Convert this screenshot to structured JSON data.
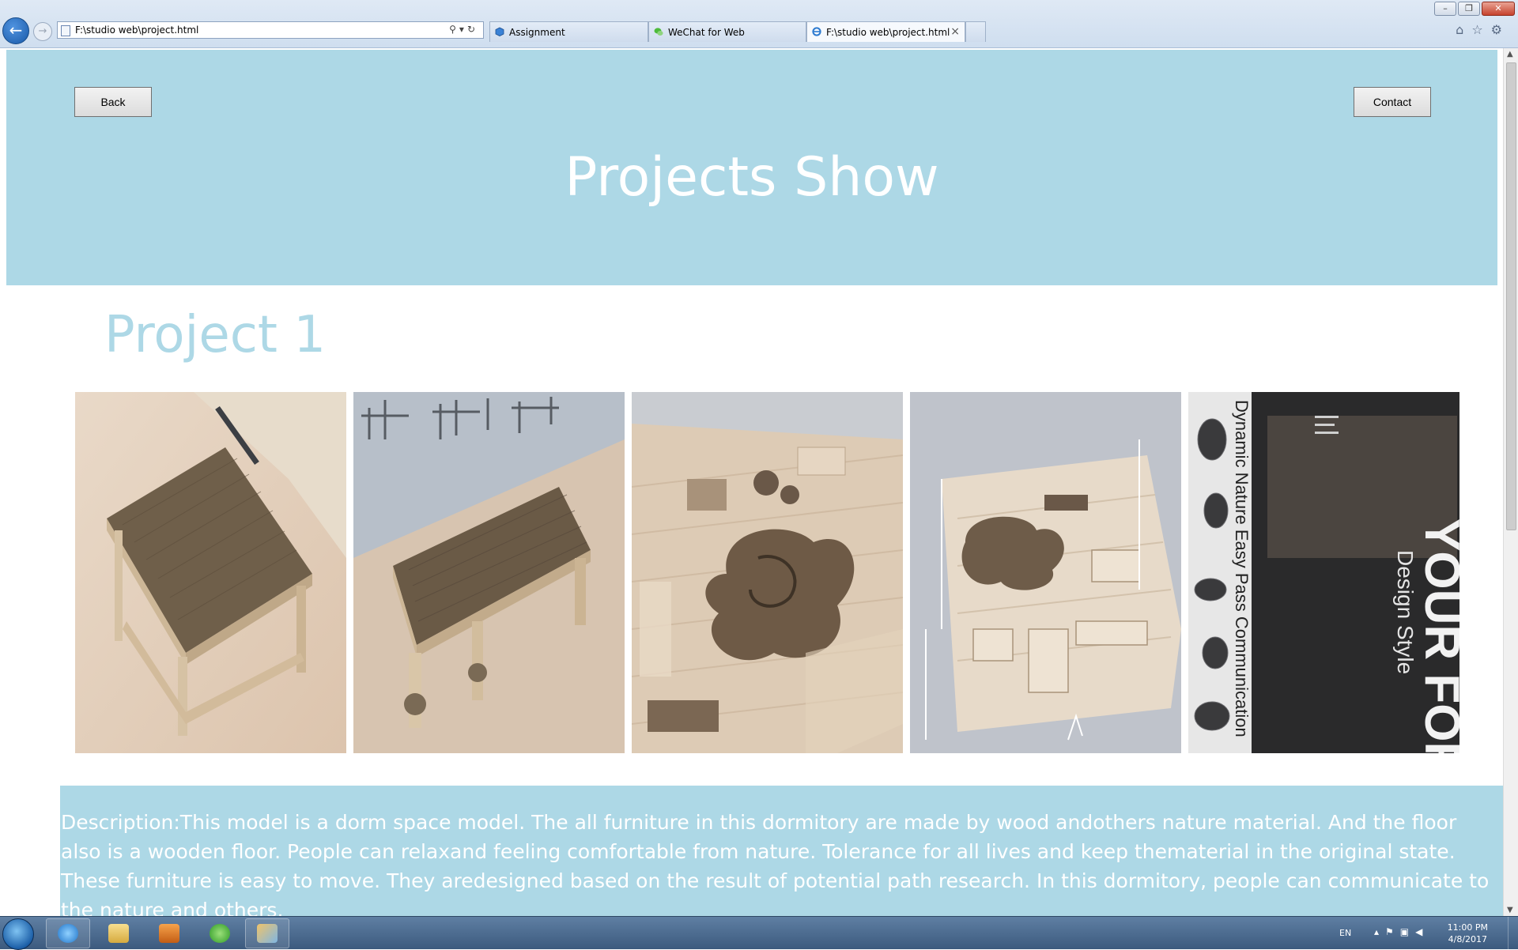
{
  "browser": {
    "address_url": "F:\\studio web\\project.html",
    "tabs": [
      {
        "label": "Assignment"
      },
      {
        "label": "WeChat for Web"
      },
      {
        "label": "F:\\studio web\\project.html"
      }
    ]
  },
  "header": {
    "back_label": "Back",
    "contact_label": "Contact",
    "title": "Projects Show",
    "background_color": "#add8e6"
  },
  "project": {
    "title": "Project 1",
    "photos": [
      {
        "icon": "bench-model-photo"
      },
      {
        "icon": "bench-model-photo"
      },
      {
        "icon": "dorm-model-photo"
      },
      {
        "icon": "dorm-model-photo"
      },
      {
        "icon": "poster-photo"
      }
    ],
    "poster_text": {
      "headline": "YOUR FOREST",
      "subtitle": "Design Style",
      "side": "Dynamic  Nature  Easy Pass  Communication"
    },
    "description": "Description:This model is a dorm space model. The all furniture in this dormitory are made by wood andothers nature material. And the floor also is a wooden floor. People can relaxand feeling comfortable from nature. Tolerance for all lives and keep thematerial in the original state. These furniture is easy to move. They aredesigned based on the result of potential path research. In this dormitory, people can communicate to the nature and others."
  },
  "taskbar": {
    "language": "EN",
    "time": "11:00 PM",
    "date": "4/8/2017"
  }
}
